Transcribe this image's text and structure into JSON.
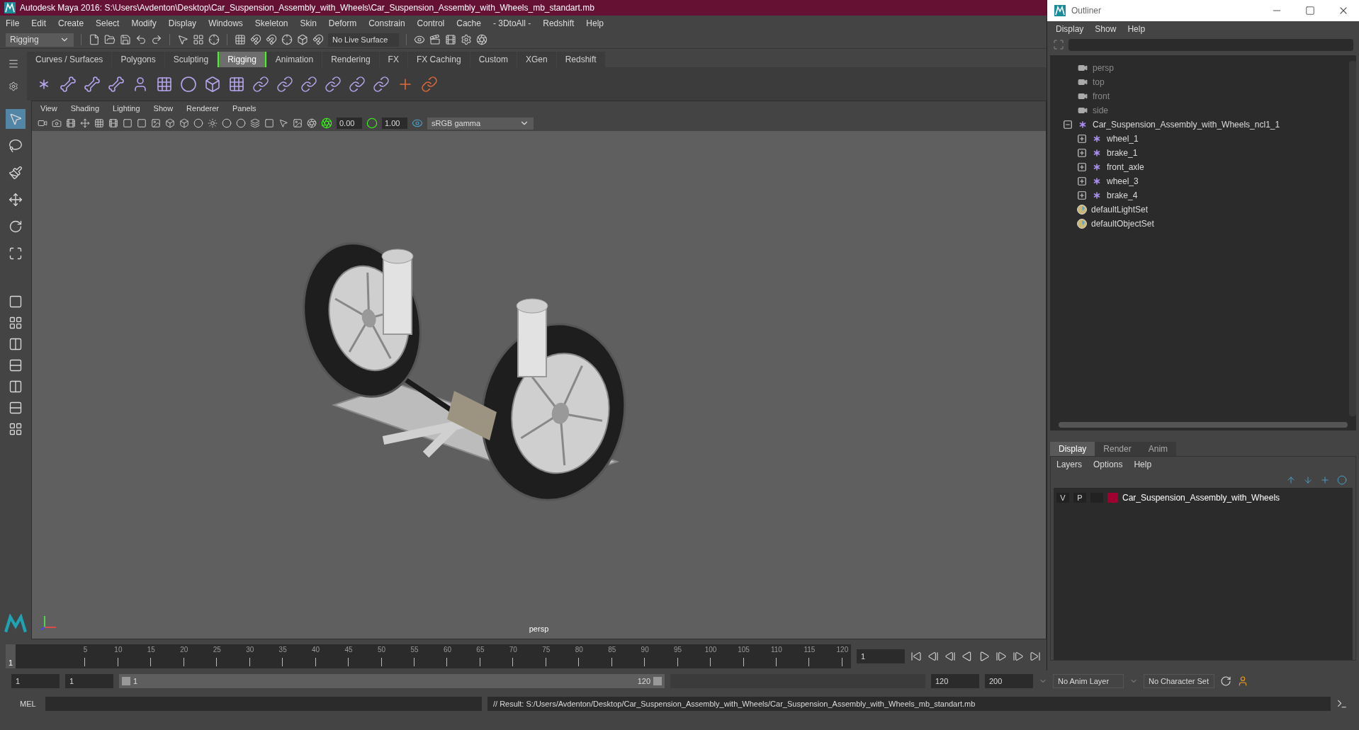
{
  "window": {
    "title": "Autodesk Maya 2016: S:\\Users\\Avdenton\\Desktop\\Car_Suspension_Assembly_with_Wheels\\Car_Suspension_Assembly_with_Wheels_mb_standart.mb"
  },
  "menu": [
    "File",
    "Edit",
    "Create",
    "Select",
    "Modify",
    "Display",
    "Windows",
    "Skeleton",
    "Skin",
    "Deform",
    "Constrain",
    "Control",
    "Cache",
    "- 3DtoAll -",
    "Redshift",
    "Help"
  ],
  "toolbar": {
    "mode": "Rigging",
    "live_surface": "No Live Surface"
  },
  "shelf": {
    "tabs": [
      {
        "label": "Curves / Surfaces",
        "selected": false
      },
      {
        "label": "Polygons",
        "selected": false
      },
      {
        "label": "Sculpting",
        "selected": false
      },
      {
        "label": "Rigging",
        "selected": true
      },
      {
        "label": "Animation",
        "selected": false
      },
      {
        "label": "Rendering",
        "selected": false
      },
      {
        "label": "FX",
        "selected": false
      },
      {
        "label": "FX Caching",
        "selected": false
      },
      {
        "label": "Custom",
        "selected": false
      },
      {
        "label": "XGen",
        "selected": false
      },
      {
        "label": "Redshift",
        "selected": false
      }
    ]
  },
  "viewport": {
    "menu": [
      "View",
      "Shading",
      "Lighting",
      "Show",
      "Renderer",
      "Panels"
    ],
    "exposure": "0.00",
    "gamma": "1.00",
    "color_space": "sRGB gamma",
    "camera_label": "persp"
  },
  "timeline": {
    "level": 0,
    "ticks": [
      "5",
      "10",
      "15",
      "20",
      "25",
      "30",
      "35",
      "40",
      "45",
      "50",
      "55",
      "60",
      "65",
      "70",
      "75",
      "80",
      "85",
      "90",
      "95",
      "100",
      "105",
      "110",
      "115",
      "120"
    ],
    "current": "1",
    "current_frame": "1"
  },
  "range": {
    "level": 1,
    "start": "1",
    "playback_start": "1",
    "slider_start": "1",
    "slider_end": "120",
    "playback_end": "120",
    "end": "200",
    "anim_layer": "No Anim Layer",
    "character_set": "No Character Set"
  },
  "command_line": {
    "language": "MEL",
    "result": "// Result: S:/Users/Avdenton/Desktop/Car_Suspension_Assembly_with_Wheels/Car_Suspension_Assembly_with_Wheels_mb_standart.mb"
  },
  "outliner": {
    "title": "Outliner",
    "menu": [
      "Display",
      "Show",
      "Help"
    ],
    "items": [
      {
        "kind": "camera",
        "label": "persp"
      },
      {
        "kind": "camera",
        "label": "top"
      },
      {
        "kind": "camera",
        "label": "front"
      },
      {
        "kind": "camera",
        "label": "side"
      },
      {
        "kind": "group",
        "label": "Car_Suspension_Assembly_with_Wheels_ncl1_1",
        "expanded": true,
        "children": [
          {
            "kind": "group",
            "label": "wheel_1",
            "expanded": false
          },
          {
            "kind": "group",
            "label": "brake_1",
            "expanded": false
          },
          {
            "kind": "group",
            "label": "front_axle",
            "expanded": false
          },
          {
            "kind": "group",
            "label": "wheel_3",
            "expanded": false
          },
          {
            "kind": "group",
            "label": "brake_4",
            "expanded": false
          }
        ]
      },
      {
        "kind": "set",
        "label": "defaultLightSet"
      },
      {
        "kind": "set",
        "label": "defaultObjectSet"
      }
    ]
  },
  "layer_editor": {
    "tabs": [
      {
        "label": "Display",
        "selected": true
      },
      {
        "label": "Render",
        "selected": false
      },
      {
        "label": "Anim",
        "selected": false
      }
    ],
    "menu": [
      "Layers",
      "Options",
      "Help"
    ],
    "layers": [
      {
        "visible": "V",
        "playback": "P",
        "color": "#a00030",
        "name": "Car_Suspension_Assembly_with_Wheels"
      }
    ]
  }
}
